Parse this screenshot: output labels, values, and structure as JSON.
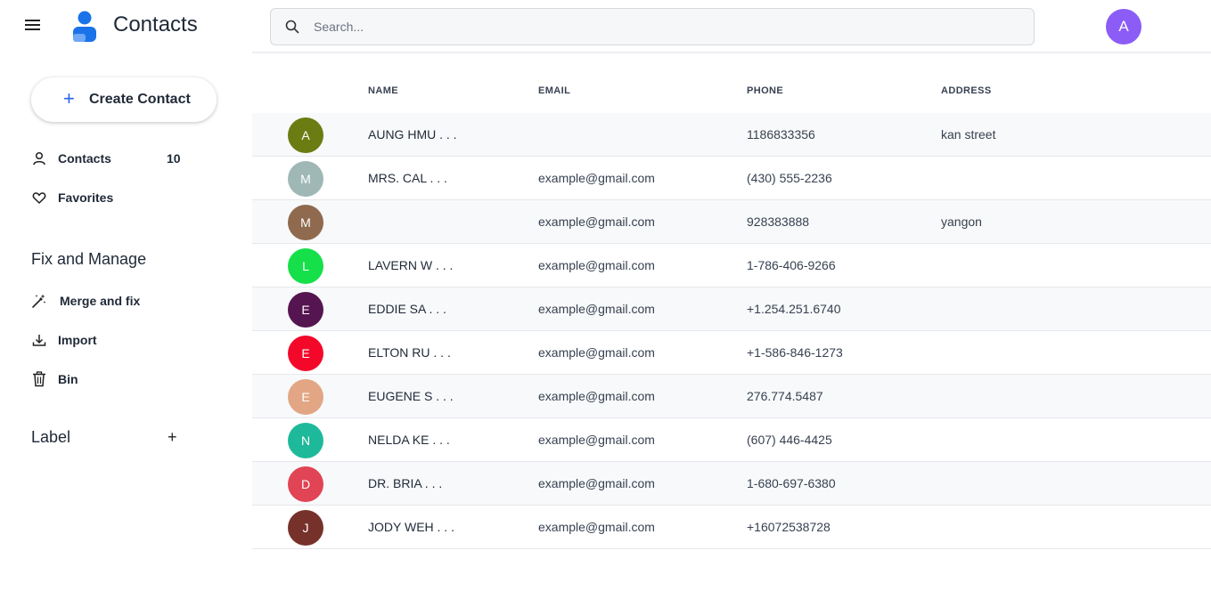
{
  "header": {
    "title": "Contacts",
    "search_placeholder": "Search...",
    "user_initial": "A",
    "user_color": "#8b5cf6"
  },
  "sidebar": {
    "create_label": "Create Contact",
    "nav": [
      {
        "label": "Contacts",
        "count": "10",
        "icon": "person-icon"
      },
      {
        "label": "Favorites",
        "icon": "heart-icon"
      }
    ],
    "fix_title": "Fix and Manage",
    "fix_items": [
      {
        "label": "Merge and fix",
        "icon": "magic-wand-icon"
      },
      {
        "label": "Import",
        "icon": "download-icon"
      },
      {
        "label": "Bin",
        "icon": "trash-icon"
      }
    ],
    "label_title": "Label",
    "label_add": "+"
  },
  "table": {
    "headers": {
      "name": "NAME",
      "email": "EMAIL",
      "phone": "PHONE",
      "address": "ADDRESS"
    },
    "rows": [
      {
        "initial": "A",
        "color": "#6b7c12",
        "name": "AUNG HMU . . .",
        "email": "",
        "phone": "1186833356",
        "address": "kan street"
      },
      {
        "initial": "M",
        "color": "#9fb8b6",
        "name": "MRS. CAL . . .",
        "email": "example@gmail.com",
        "phone": "(430) 555-2236",
        "address": ""
      },
      {
        "initial": "M",
        "color": "#8f6a4e",
        "name": "",
        "email": "example@gmail.com",
        "phone": "928383888",
        "address": "yangon"
      },
      {
        "initial": "L",
        "color": "#15e04a",
        "name": "LAVERN W . . .",
        "email": "example@gmail.com",
        "phone": "1-786-406-9266",
        "address": ""
      },
      {
        "initial": "E",
        "color": "#551550",
        "name": "EDDIE SA . . .",
        "email": "example@gmail.com",
        "phone": "+1.254.251.6740",
        "address": ""
      },
      {
        "initial": "E",
        "color": "#f4082a",
        "name": "ELTON RU . . .",
        "email": "example@gmail.com",
        "phone": "+1-586-846-1273",
        "address": ""
      },
      {
        "initial": "E",
        "color": "#e2a684",
        "name": "EUGENE S . . .",
        "email": "example@gmail.com",
        "phone": "276.774.5487",
        "address": ""
      },
      {
        "initial": "N",
        "color": "#1eb99a",
        "name": "NELDA KE . . .",
        "email": "example@gmail.com",
        "phone": "(607) 446-4425",
        "address": ""
      },
      {
        "initial": "D",
        "color": "#e14455",
        "name": "DR. BRIA . . .",
        "email": "example@gmail.com",
        "phone": "1-680-697-6380",
        "address": ""
      },
      {
        "initial": "J",
        "color": "#76322a",
        "name": "JODY WEH . . .",
        "email": "example@gmail.com",
        "phone": "+16072538728",
        "address": ""
      }
    ]
  }
}
